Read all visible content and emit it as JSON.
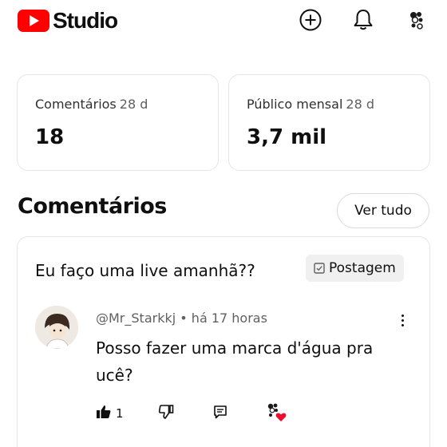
{
  "header": {
    "app_title": "Studio",
    "icons": [
      "youtube-logo-icon",
      "create-plus-icon",
      "bell-icon",
      "avatar-icon"
    ]
  },
  "stats": [
    {
      "label": "Comentários",
      "period": "28 d",
      "value": "18"
    },
    {
      "label": "Público mensal",
      "period": "28 d",
      "value": "3,7 mil"
    }
  ],
  "comments_section": {
    "title": "Comentários",
    "see_all_label": "Ver tudo",
    "post": {
      "title": "Eu faço uma live amanhã??",
      "badge_label": "Postagem"
    },
    "comment": {
      "author": "@Mr_Starkkj",
      "separator": "•",
      "time": "há 17 horas",
      "text": "Posso fazer uma marca d'água pra ucê?",
      "like_count": "1"
    }
  },
  "colors": {
    "brand_red": "#ff0000",
    "text_primary": "#0f0f0f",
    "text_secondary": "#606060",
    "heart": "#e8102d",
    "badge_bg": "#f0f0f0"
  }
}
